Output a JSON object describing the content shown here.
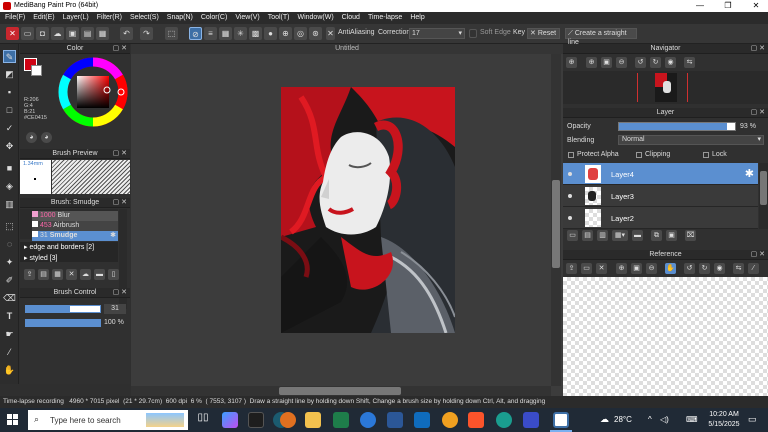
{
  "window": {
    "title": "MediBang Paint Pro (64bit)",
    "minimize": "—",
    "maximize": "❐",
    "close": "✕"
  },
  "menu": [
    "File(F)",
    "Edit(E)",
    "Layer(L)",
    "Filter(R)",
    "Select(S)",
    "Snap(N)",
    "Color(C)",
    "View(V)",
    "Tool(T)",
    "Window(W)",
    "Cloud",
    "Time-lapse",
    "Help"
  ],
  "toolbar": {
    "antialiasing_label": "AntiAliasing",
    "correction_label": "Correction",
    "correction_value": "17",
    "soft_edge_label": "Soft Edge",
    "key_label": "Key",
    "reset_label": "Reset",
    "straight_line_label": "Create a straight line"
  },
  "color_panel": {
    "title": "Color",
    "r": "R:206",
    "g": "G:4",
    "b": "B:21",
    "hex": "#CE0415",
    "primary_color": "#CE0415"
  },
  "brush_preview": {
    "title": "Brush Preview",
    "size": "1.34mm"
  },
  "brush_panel": {
    "title": "Brush: Smudge",
    "items": [
      {
        "size": "1000",
        "name": "Blur"
      },
      {
        "size": "453",
        "name": "Airbrush"
      },
      {
        "size": "31",
        "name": "Smudge"
      }
    ],
    "groups": [
      "edge and borders [2]",
      "styled [3]"
    ]
  },
  "brush_control": {
    "title": "Brush Control",
    "size_value": "31",
    "opacity_value": "100 %",
    "size_fraction": 0.6,
    "opacity_fraction": 1.0
  },
  "canvas": {
    "doc_title": "Untitled"
  },
  "navigator": {
    "title": "Navigator"
  },
  "layer_panel": {
    "title": "Layer",
    "opacity_label": "Opacity",
    "opacity_value": "93 %",
    "opacity_fraction": 0.93,
    "blending_label": "Blending",
    "blending_value": "Normal",
    "protect_alpha": "Protect Alpha",
    "clipping": "Clipping",
    "lock": "Lock",
    "layers": [
      "Layer4",
      "Layer3",
      "Layer2"
    ]
  },
  "reference_panel": {
    "title": "Reference"
  },
  "status": {
    "recording": "Time-lapse recording",
    "dimensions": "4960 * 7015 pixel",
    "physical": "(21 * 29.7cm)",
    "dpi": "600 dpi",
    "zoom": "6 %",
    "coords": "( 7553, 3107 )",
    "hint": "Draw a straight line by holding down Shift, Change a brush size by holding down Ctrl, Alt, and dragging"
  },
  "taskbar": {
    "search_placeholder": "Type here to search",
    "temp": "28°C",
    "time": "10:20 AM",
    "date": "5/15/2025"
  }
}
